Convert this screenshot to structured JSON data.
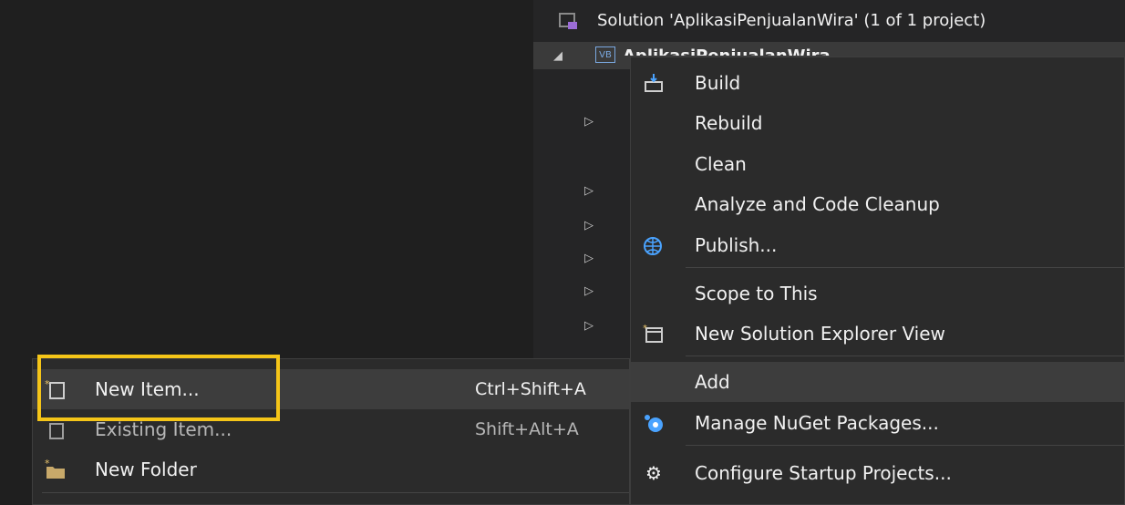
{
  "tree": {
    "solution_label": "Solution 'AplikasiPenjualanWira' (1 of 1 project)",
    "project_label": "AplikasiPenjualanWira",
    "vb_badge": "VB"
  },
  "context_menu": {
    "items": [
      {
        "label": "Build",
        "icon": "build-icon"
      },
      {
        "label": "Rebuild"
      },
      {
        "label": "Clean"
      },
      {
        "label": "Analyze and Code Cleanup"
      },
      {
        "label": "Publish...",
        "icon": "globe-icon"
      },
      {
        "label": "Scope to This"
      },
      {
        "label": "New Solution Explorer View",
        "icon": "new-window-icon"
      },
      {
        "label": "Add"
      },
      {
        "label": "Manage NuGet Packages...",
        "icon": "nuget-icon"
      },
      {
        "label": "Configure Startup Projects...",
        "icon": "gear-icon"
      }
    ]
  },
  "add_submenu": {
    "items": [
      {
        "label": "New Item...",
        "shortcut": "Ctrl+Shift+A",
        "icon": "new-item-icon"
      },
      {
        "label": "Existing Item...",
        "shortcut": "Shift+Alt+A",
        "icon": "existing-item-icon"
      },
      {
        "label": "New Folder",
        "icon": "new-folder-icon"
      }
    ]
  },
  "colors": {
    "highlight_border": "#f5c518",
    "menu_bg": "#2b2b2b",
    "hover_bg": "#3d3d3d"
  }
}
